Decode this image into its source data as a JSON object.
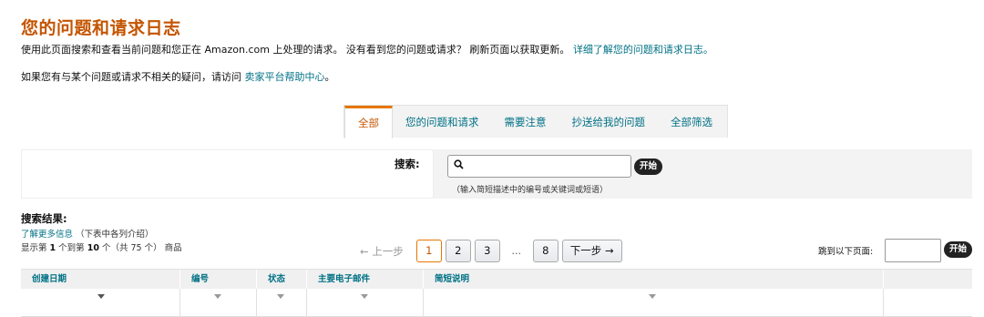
{
  "header": {
    "title": "您的问题和请求日志",
    "line1_text": "使用此页面搜索和查看当前问题和您正在 Amazon.com 上处理的请求。 没有看到您的问题或请求？ 刷新页面以获取更新。",
    "line1_link": "详细了解您的问题和请求日志。",
    "line2_text": "如果您有与某个问题或请求不相关的疑问，请访问",
    "line2_link": "卖家平台帮助中心",
    "line2_end": "。"
  },
  "tabs": [
    {
      "label": "全部",
      "active": true
    },
    {
      "label": "您的问题和请求",
      "active": false
    },
    {
      "label": "需要注意",
      "active": false
    },
    {
      "label": "抄送给我的问题",
      "active": false
    },
    {
      "label": "全部筛选",
      "active": false
    }
  ],
  "search": {
    "label": "搜索:",
    "value": "",
    "placeholder": "",
    "button": "开始",
    "hint": "（输入简短描述中的编号或关键词或短语）",
    "icon": "search-icon"
  },
  "results": {
    "title": "搜索结果:",
    "learn_more": "了解更多信息",
    "learn_more_note": "（下表中各列介绍）",
    "count_prefix": "显示第 ",
    "count_from": "1",
    "count_mid": " 个到第 ",
    "count_to": "10",
    "count_suffix": " 个（共 75 个） 商品"
  },
  "pagination": {
    "prev": "← 上一步",
    "pages": [
      "1",
      "2",
      "3"
    ],
    "current": "1",
    "ellipsis": "...",
    "last": "8",
    "next": "下一步 →",
    "jump_label": "跳到以下页面:",
    "jump_value": "",
    "jump_button": "开始"
  },
  "table": {
    "columns": [
      "创建日期",
      "编号",
      "状态",
      "主要电子邮件",
      "简短说明",
      ""
    ]
  },
  "colors": {
    "title": "#c45500",
    "link": "#007185",
    "active_tab_border": "#e77600"
  }
}
